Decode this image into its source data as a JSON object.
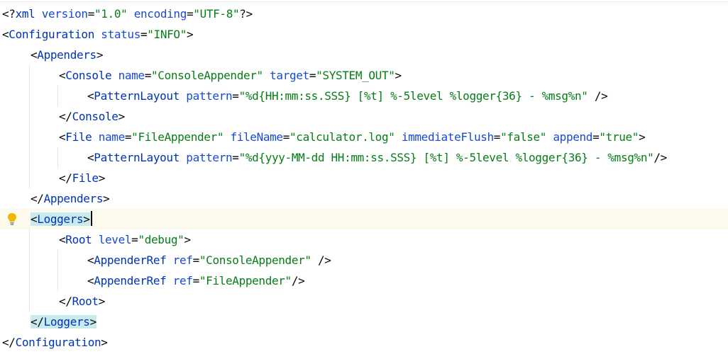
{
  "colors": {
    "tag": "#0033b3",
    "attr_name": "#174ad4",
    "attr_value": "#067d17",
    "punct": "#080808",
    "pi_attr": "#174ad4",
    "tag_match_bg": "#c9ebee",
    "current_line_bg": "#fcfaed",
    "bulb": "#f2b600"
  },
  "icons": {
    "intention_bulb": "lightbulb-icon"
  },
  "lines": [
    {
      "indent": 0,
      "tokens": [
        {
          "t": "<?",
          "c": "punct"
        },
        {
          "t": "xml",
          "c": "tag"
        },
        {
          "t": " "
        },
        {
          "t": "version",
          "c": "attr_name"
        },
        {
          "t": "=",
          "c": "punct"
        },
        {
          "t": "\"1.0\"",
          "c": "attr_value"
        },
        {
          "t": " "
        },
        {
          "t": "encoding",
          "c": "attr_name"
        },
        {
          "t": "=",
          "c": "punct"
        },
        {
          "t": "\"UTF-8\"",
          "c": "attr_value"
        },
        {
          "t": "?>",
          "c": "punct"
        }
      ]
    },
    {
      "indent": 0,
      "tokens": [
        {
          "t": "<",
          "c": "punct"
        },
        {
          "t": "Configuration",
          "c": "tag"
        },
        {
          "t": " "
        },
        {
          "t": "status",
          "c": "attr_name"
        },
        {
          "t": "=",
          "c": "punct"
        },
        {
          "t": "\"INFO\"",
          "c": "attr_value"
        },
        {
          "t": ">",
          "c": "punct"
        }
      ]
    },
    {
      "indent": 1,
      "tokens": [
        {
          "t": "<",
          "c": "punct"
        },
        {
          "t": "Appenders",
          "c": "tag"
        },
        {
          "t": ">",
          "c": "punct"
        }
      ]
    },
    {
      "indent": 2,
      "tokens": [
        {
          "t": "<",
          "c": "punct"
        },
        {
          "t": "Console",
          "c": "tag"
        },
        {
          "t": " "
        },
        {
          "t": "name",
          "c": "attr_name"
        },
        {
          "t": "=",
          "c": "punct"
        },
        {
          "t": "\"ConsoleAppender\"",
          "c": "attr_value"
        },
        {
          "t": " "
        },
        {
          "t": "target",
          "c": "attr_name"
        },
        {
          "t": "=",
          "c": "punct"
        },
        {
          "t": "\"SYSTEM_OUT\"",
          "c": "attr_value"
        },
        {
          "t": ">",
          "c": "punct"
        }
      ]
    },
    {
      "indent": 3,
      "tokens": [
        {
          "t": "<",
          "c": "punct"
        },
        {
          "t": "PatternLayout",
          "c": "tag"
        },
        {
          "t": " "
        },
        {
          "t": "pattern",
          "c": "attr_name"
        },
        {
          "t": "=",
          "c": "punct"
        },
        {
          "t": "\"%d{HH:mm:ss.SSS} [%t] %-5level %logger{36} - %msg%n\"",
          "c": "attr_value"
        },
        {
          "t": " "
        },
        {
          "t": "/>",
          "c": "punct"
        }
      ]
    },
    {
      "indent": 2,
      "tokens": [
        {
          "t": "</",
          "c": "punct"
        },
        {
          "t": "Console",
          "c": "tag"
        },
        {
          "t": ">",
          "c": "punct"
        }
      ]
    },
    {
      "indent": 2,
      "tokens": [
        {
          "t": "<",
          "c": "punct"
        },
        {
          "t": "File",
          "c": "tag"
        },
        {
          "t": " "
        },
        {
          "t": "name",
          "c": "attr_name"
        },
        {
          "t": "=",
          "c": "punct"
        },
        {
          "t": "\"FileAppender\"",
          "c": "attr_value"
        },
        {
          "t": " "
        },
        {
          "t": "fileName",
          "c": "attr_name"
        },
        {
          "t": "=",
          "c": "punct"
        },
        {
          "t": "\"calculator.log\"",
          "c": "attr_value"
        },
        {
          "t": " "
        },
        {
          "t": "immediateFlush",
          "c": "attr_name"
        },
        {
          "t": "=",
          "c": "punct"
        },
        {
          "t": "\"false\"",
          "c": "attr_value"
        },
        {
          "t": " "
        },
        {
          "t": "append",
          "c": "attr_name"
        },
        {
          "t": "=",
          "c": "punct"
        },
        {
          "t": "\"true\"",
          "c": "attr_value"
        },
        {
          "t": ">",
          "c": "punct"
        }
      ]
    },
    {
      "indent": 3,
      "tokens": [
        {
          "t": "<",
          "c": "punct"
        },
        {
          "t": "PatternLayout",
          "c": "tag"
        },
        {
          "t": " "
        },
        {
          "t": "pattern",
          "c": "attr_name"
        },
        {
          "t": "=",
          "c": "punct"
        },
        {
          "t": "\"%d{yyy-MM-dd HH:mm:ss.SSS} [%t] %-5level %logger{36} - %msg%n\"",
          "c": "attr_value"
        },
        {
          "t": "/>",
          "c": "punct"
        }
      ]
    },
    {
      "indent": 2,
      "tokens": [
        {
          "t": "</",
          "c": "punct"
        },
        {
          "t": "File",
          "c": "tag"
        },
        {
          "t": ">",
          "c": "punct"
        }
      ]
    },
    {
      "indent": 1,
      "tokens": [
        {
          "t": "</",
          "c": "punct"
        },
        {
          "t": "Appenders",
          "c": "tag"
        },
        {
          "t": ">",
          "c": "punct"
        }
      ]
    },
    {
      "indent": 1,
      "current": true,
      "bulb": true,
      "caret_after": true,
      "match": true,
      "tokens": [
        {
          "t": "<",
          "c": "punct"
        },
        {
          "t": "Loggers",
          "c": "tag"
        },
        {
          "t": ">",
          "c": "punct"
        }
      ]
    },
    {
      "indent": 2,
      "tokens": [
        {
          "t": "<",
          "c": "punct"
        },
        {
          "t": "Root",
          "c": "tag"
        },
        {
          "t": " "
        },
        {
          "t": "level",
          "c": "attr_name"
        },
        {
          "t": "=",
          "c": "punct"
        },
        {
          "t": "\"debug\"",
          "c": "attr_value"
        },
        {
          "t": ">",
          "c": "punct"
        }
      ]
    },
    {
      "indent": 3,
      "tokens": [
        {
          "t": "<",
          "c": "punct"
        },
        {
          "t": "AppenderRef",
          "c": "tag"
        },
        {
          "t": " "
        },
        {
          "t": "ref",
          "c": "attr_name"
        },
        {
          "t": "=",
          "c": "punct"
        },
        {
          "t": "\"ConsoleAppender\"",
          "c": "attr_value"
        },
        {
          "t": " "
        },
        {
          "t": "/>",
          "c": "punct"
        }
      ]
    },
    {
      "indent": 3,
      "tokens": [
        {
          "t": "<",
          "c": "punct"
        },
        {
          "t": "AppenderRef",
          "c": "tag"
        },
        {
          "t": " "
        },
        {
          "t": "ref",
          "c": "attr_name"
        },
        {
          "t": "=",
          "c": "punct"
        },
        {
          "t": "\"FileAppender\"",
          "c": "attr_value"
        },
        {
          "t": "/>",
          "c": "punct"
        }
      ]
    },
    {
      "indent": 2,
      "tokens": [
        {
          "t": "</",
          "c": "punct"
        },
        {
          "t": "Root",
          "c": "tag"
        },
        {
          "t": ">",
          "c": "punct"
        }
      ]
    },
    {
      "indent": 1,
      "match": true,
      "tokens": [
        {
          "t": "</",
          "c": "punct"
        },
        {
          "t": "Loggers",
          "c": "tag"
        },
        {
          "t": ">",
          "c": "punct"
        }
      ]
    },
    {
      "indent": 0,
      "tokens": [
        {
          "t": "</",
          "c": "punct"
        },
        {
          "t": "Configuration",
          "c": "tag"
        },
        {
          "t": ">",
          "c": "punct"
        }
      ]
    }
  ]
}
